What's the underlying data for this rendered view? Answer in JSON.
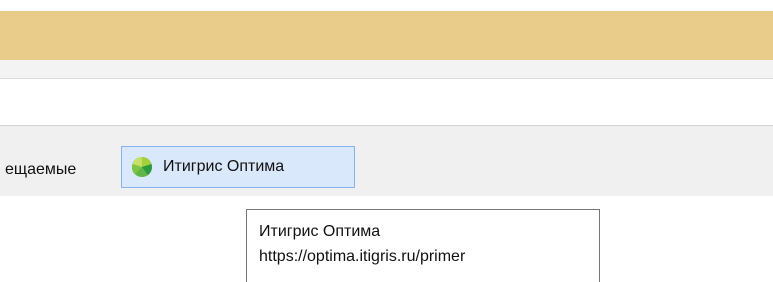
{
  "bookmarks": {
    "partial_label": "ещаемые",
    "active": {
      "label": "Итигрис Оптима",
      "icon": "green-pie-favicon-icon"
    }
  },
  "tooltip": {
    "title": "Итигрис Оптима",
    "url": "https://optima.itigris.ru/primer"
  },
  "colors": {
    "header_band": "#e9cb8a",
    "bookmark_highlight": "#d9e8fa",
    "bookmark_highlight_border": "#86b3ec",
    "favicon_green": "#4caf50",
    "favicon_light_green": "#9ccc3c"
  }
}
